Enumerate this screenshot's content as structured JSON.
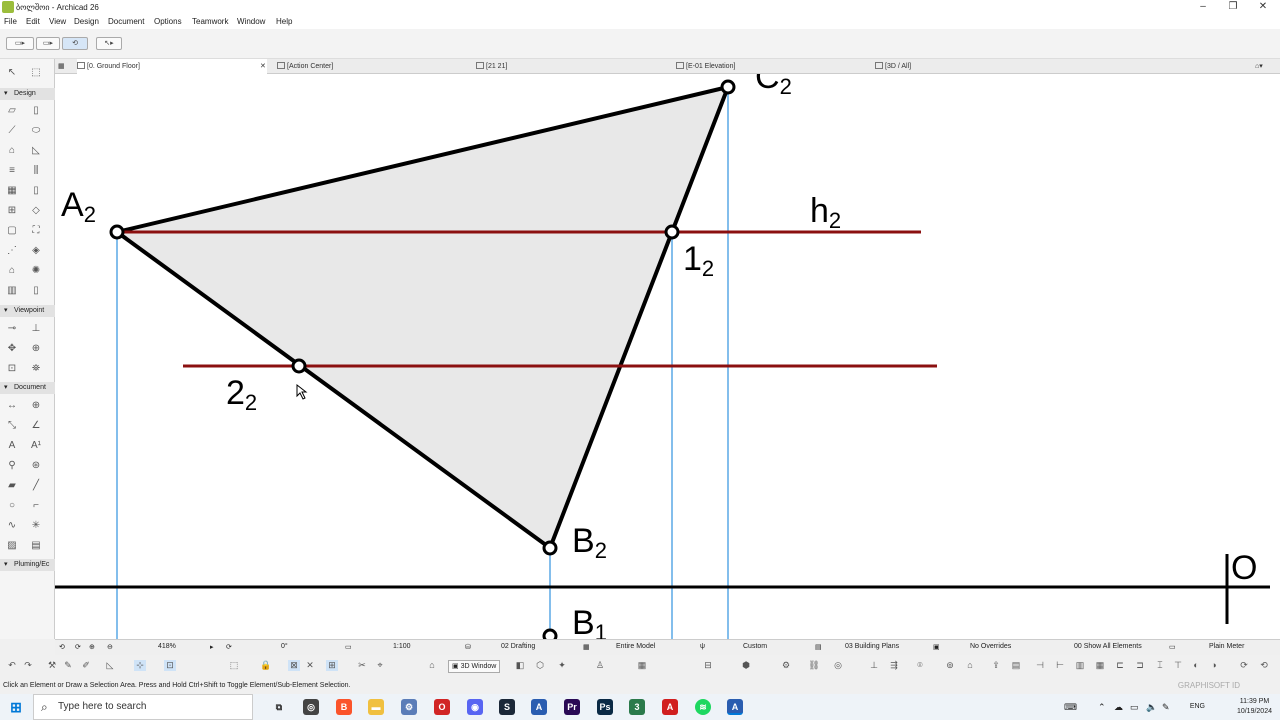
{
  "window": {
    "title": "ბოლშოი - Archicad 26",
    "minimize": "–",
    "maximize": "❐",
    "close": "✕"
  },
  "menu": [
    "File",
    "Edit",
    "View",
    "Design",
    "Document",
    "Options",
    "Teamwork",
    "Window",
    "Help"
  ],
  "tabs": [
    {
      "label": "[0. Ground Floor]"
    },
    {
      "label": "[Action Center]"
    },
    {
      "label": "[21 21]"
    },
    {
      "label": "[E-01 Elevation]"
    },
    {
      "label": "[3D / All]"
    }
  ],
  "toolbox": {
    "sections": [
      "Design",
      "Viewpoint",
      "Document",
      "Pluming/Ec"
    ]
  },
  "drawing": {
    "labels": {
      "A2": {
        "main": "A",
        "sub": "2"
      },
      "B2": {
        "main": "B",
        "sub": "2"
      },
      "B1": {
        "main": "B",
        "sub": "1"
      },
      "C2": {
        "main": "C",
        "sub": "2"
      },
      "h2": {
        "main": "h",
        "sub": "2"
      },
      "one2": {
        "main": "1",
        "sub": "2"
      },
      "two2": {
        "main": "2",
        "sub": "2"
      },
      "O": "O"
    },
    "colors": {
      "triangle_fill": "#e8e8e8",
      "edge": "#000000",
      "horizontal_line": "#8b1010",
      "projection_line": "#5aa9e6",
      "axis": "#000000"
    }
  },
  "statusbar": {
    "zoom": "418%",
    "angle": "0°",
    "scale": "1:100",
    "layer_combo": "02 Drafting",
    "model": "Entire Model",
    "pen": "Custom",
    "view": "03 Building Plans",
    "overrides": "No Overrides",
    "renovation": "00 Show All Elements",
    "dimension": "Plain Meter"
  },
  "toolbar2": {
    "window_3d": "3D Window"
  },
  "hint": {
    "text": "Click an Element or Draw a Selection Area. Press and Hold Ctrl+Shift to Toggle Element/Sub-Element Selection.",
    "brand": "GRAPHISOFT ID"
  },
  "taskbar": {
    "search_placeholder": "Type here to search",
    "language": "ENG",
    "time": "11:39 PM",
    "date": "10/19/2024"
  }
}
